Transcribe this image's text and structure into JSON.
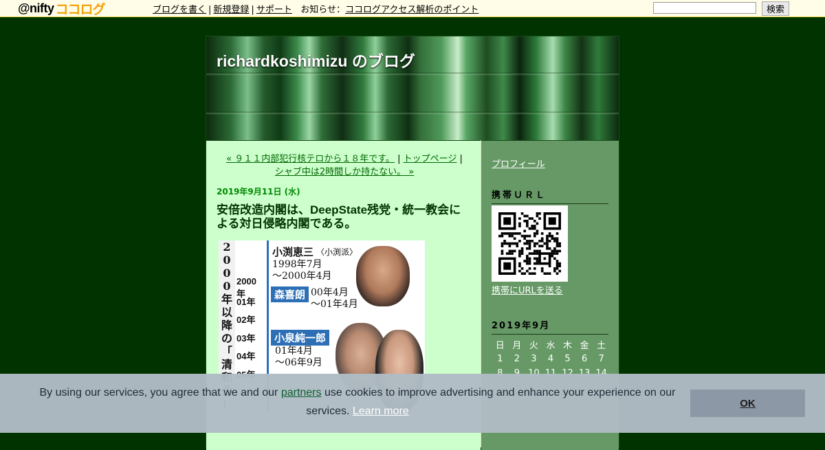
{
  "topbar": {
    "logo_prefix": "@nifty",
    "logo_brand": "ココログ",
    "nav": [
      {
        "label": "ブログを書く"
      },
      {
        "label": "新規登録"
      },
      {
        "label": "サポート"
      }
    ],
    "news_label": "お知らせ",
    "news_colon": "：",
    "news_link": "ココログアクセス解析のポイント",
    "search_button": "検索",
    "search_value": ""
  },
  "blog": {
    "title": "richardkoshimizu のブログ"
  },
  "pager": {
    "prev": "« ９１１内部犯行核テロから１８年です。",
    "sep1": " | ",
    "top": "トップページ",
    "sep2": " |",
    "next": "シャブ中は2時間しか持たない。 »"
  },
  "entry": {
    "date": "2019年9月11日 (水)",
    "title": "安倍改造内閣は、DeepState残党・統一教会による対日侵略内閣である。",
    "image": {
      "vertical_title": [
        "2",
        "0",
        "0",
        "0",
        "年",
        "以",
        "降",
        "の",
        "「",
        "清",
        "和",
        "会",
        "」"
      ],
      "years": [
        "2000年",
        "01年",
        "02年",
        "03年",
        "04年",
        "05年"
      ],
      "pm1_name": "小渕恵三",
      "pm1_faction": "〈小渕派〉",
      "pm1_term1": "1998年7月",
      "pm1_term2": "～2000年4月",
      "pm2_name": "森喜朗",
      "pm2_term1": "00年4月",
      "pm2_term2": "～01年4月",
      "pm3_name": "小泉純一郎",
      "pm3_term1": "01年4月",
      "pm3_term2": "～06年9月"
    }
  },
  "sidebar": {
    "profile": "プロフィール",
    "mobile_heading": "携帯ＵＲＬ",
    "send_url": "携帯にURLを送る",
    "calendar_heading": "2019年9月",
    "weekdays": [
      "日",
      "月",
      "火",
      "水",
      "木",
      "金",
      "土"
    ],
    "weeks": [
      [
        "1",
        "2",
        "3",
        "4",
        "5",
        "6",
        "7"
      ],
      [
        "8",
        "9",
        "10",
        "11",
        "12",
        "13",
        "14"
      ]
    ]
  },
  "cookie": {
    "text_before": "By using our services, you agree that we and our ",
    "partners": "partners",
    "text_after": " use cookies to improve advertising and enhance your experience on our services. ",
    "learn_more": "Learn more",
    "ok": "OK"
  },
  "colors": {
    "page_bg": "#003300",
    "content_bg": "#ccffcc",
    "sidebar_bg": "#669966",
    "date_color": "#008800",
    "cookie_bg": "#b0bcc4"
  }
}
